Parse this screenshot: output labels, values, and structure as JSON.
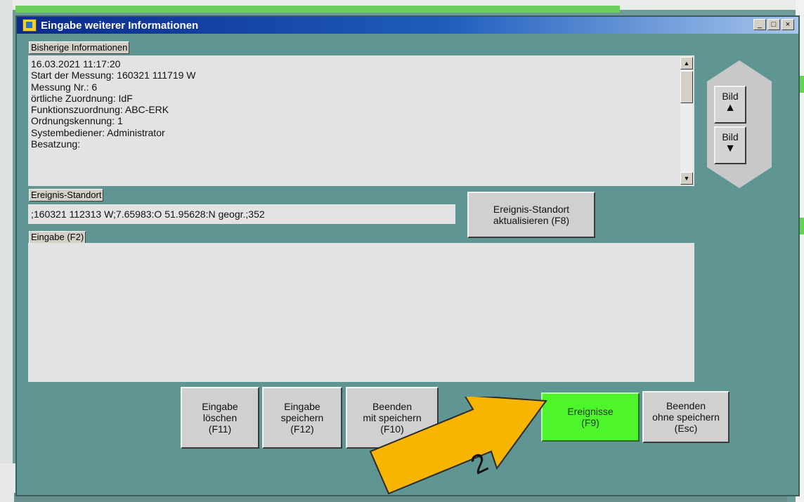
{
  "window": {
    "title": "Eingabe weiterer Informationen",
    "controls": {
      "minimize": "_",
      "maximize": "□",
      "close": "×"
    }
  },
  "info_section": {
    "label": "Bisherige Informationen",
    "lines": [
      "16.03.2021 11:17:20",
      "Start der Messung: 160321 111719 W",
      "Messung Nr.:  6",
      "örtliche Zuordnung: IdF",
      "Funktionszuordnung: ABC-ERK",
      "Ordnungskennung: 1",
      "Systembediener:  Administrator",
      "Besatzung:"
    ],
    "scroll_up": "▲",
    "scroll_down": "▼"
  },
  "location_section": {
    "label": "Ereignis-Standort",
    "value": ";160321 112313 W;7.65983:O 51.95628:N geogr.;352",
    "update_button": "Ereignis-Standort\naktualisieren (F8)"
  },
  "input_section": {
    "label": "Eingabe (F2)",
    "value": ""
  },
  "nav": {
    "up_label": "Bild",
    "up_arrow": "▲",
    "down_label": "Bild",
    "down_arrow": "▼"
  },
  "buttons": {
    "clear": "Eingabe\nlöschen\n(F11)",
    "save": "Eingabe\nspeichern\n(F12)",
    "exit_save": "Beenden\nmit speichern\n(F10)",
    "events": "Ereignisse\n(F9)",
    "exit_nosave": "Beenden\nohne speichern\n(Esc)"
  },
  "annotation": {
    "number": "2",
    "arrow_color": "#f7b500"
  },
  "colors": {
    "background": "#5f9593",
    "events_button": "#4ef52a"
  }
}
